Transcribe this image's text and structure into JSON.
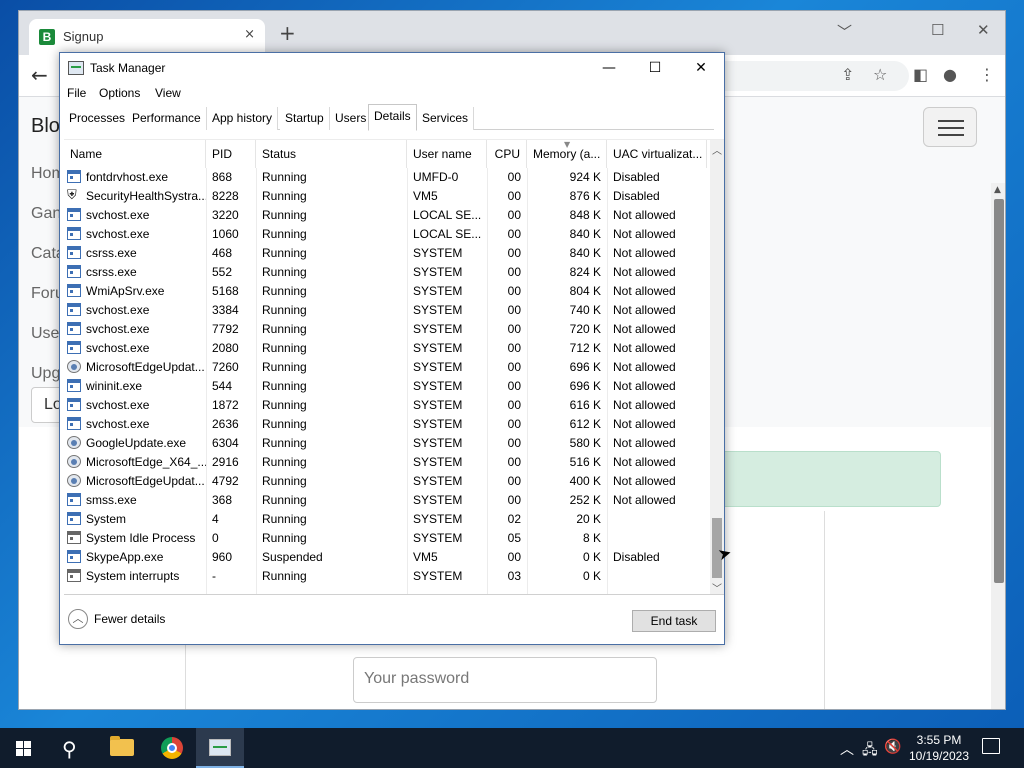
{
  "browser": {
    "tab_title": "Signup",
    "favicon_letter": "B",
    "tab_close": "×",
    "new_tab": "+",
    "back": "←",
    "win_min": "﹀",
    "win_max": "☐",
    "win_close": "✕",
    "page": {
      "brand": "Blo",
      "sidebar": [
        "Hom",
        "Gan",
        "Cata",
        "Foru",
        "Use",
        "Upg"
      ],
      "login_button": "Lo",
      "password_placeholder": "Your password"
    }
  },
  "task_manager": {
    "title": "Task Manager",
    "controls": {
      "minimize": "—",
      "maximize": "☐",
      "close": "✕"
    },
    "menu": [
      "File",
      "Options",
      "View"
    ],
    "tabs": [
      {
        "label": "Processes"
      },
      {
        "label": "Performance"
      },
      {
        "label": "App history"
      },
      {
        "label": "Startup"
      },
      {
        "label": "Users"
      },
      {
        "label": "Details",
        "active": true
      },
      {
        "label": "Services"
      }
    ],
    "columns": [
      "Name",
      "PID",
      "Status",
      "User name",
      "CPU",
      "Memory (a...",
      "UAC virtualizat..."
    ],
    "rows": [
      {
        "name": "fontdrvhost.exe",
        "pid": "868",
        "status": "Running",
        "user": "UMFD-0",
        "cpu": "00",
        "memory": "924 K",
        "uac": "Disabled",
        "icon": "app"
      },
      {
        "name": "SecurityHealthSystra...",
        "pid": "8228",
        "status": "Running",
        "user": "VM5",
        "cpu": "00",
        "memory": "876 K",
        "uac": "Disabled",
        "icon": "shield"
      },
      {
        "name": "svchost.exe",
        "pid": "3220",
        "status": "Running",
        "user": "LOCAL SE...",
        "cpu": "00",
        "memory": "848 K",
        "uac": "Not allowed",
        "icon": "app"
      },
      {
        "name": "svchost.exe",
        "pid": "1060",
        "status": "Running",
        "user": "LOCAL SE...",
        "cpu": "00",
        "memory": "840 K",
        "uac": "Not allowed",
        "icon": "app"
      },
      {
        "name": "csrss.exe",
        "pid": "468",
        "status": "Running",
        "user": "SYSTEM",
        "cpu": "00",
        "memory": "840 K",
        "uac": "Not allowed",
        "icon": "app"
      },
      {
        "name": "csrss.exe",
        "pid": "552",
        "status": "Running",
        "user": "SYSTEM",
        "cpu": "00",
        "memory": "824 K",
        "uac": "Not allowed",
        "icon": "app"
      },
      {
        "name": "WmiApSrv.exe",
        "pid": "5168",
        "status": "Running",
        "user": "SYSTEM",
        "cpu": "00",
        "memory": "804 K",
        "uac": "Not allowed",
        "icon": "app"
      },
      {
        "name": "svchost.exe",
        "pid": "3384",
        "status": "Running",
        "user": "SYSTEM",
        "cpu": "00",
        "memory": "740 K",
        "uac": "Not allowed",
        "icon": "app"
      },
      {
        "name": "svchost.exe",
        "pid": "7792",
        "status": "Running",
        "user": "SYSTEM",
        "cpu": "00",
        "memory": "720 K",
        "uac": "Not allowed",
        "icon": "app"
      },
      {
        "name": "svchost.exe",
        "pid": "2080",
        "status": "Running",
        "user": "SYSTEM",
        "cpu": "00",
        "memory": "712 K",
        "uac": "Not allowed",
        "icon": "app"
      },
      {
        "name": "MicrosoftEdgeUpdat...",
        "pid": "7260",
        "status": "Running",
        "user": "SYSTEM",
        "cpu": "00",
        "memory": "696 K",
        "uac": "Not allowed",
        "icon": "update"
      },
      {
        "name": "wininit.exe",
        "pid": "544",
        "status": "Running",
        "user": "SYSTEM",
        "cpu": "00",
        "memory": "696 K",
        "uac": "Not allowed",
        "icon": "app"
      },
      {
        "name": "svchost.exe",
        "pid": "1872",
        "status": "Running",
        "user": "SYSTEM",
        "cpu": "00",
        "memory": "616 K",
        "uac": "Not allowed",
        "icon": "app"
      },
      {
        "name": "svchost.exe",
        "pid": "2636",
        "status": "Running",
        "user": "SYSTEM",
        "cpu": "00",
        "memory": "612 K",
        "uac": "Not allowed",
        "icon": "app"
      },
      {
        "name": "GoogleUpdate.exe",
        "pid": "6304",
        "status": "Running",
        "user": "SYSTEM",
        "cpu": "00",
        "memory": "580 K",
        "uac": "Not allowed",
        "icon": "update"
      },
      {
        "name": "MicrosoftEdge_X64_...",
        "pid": "2916",
        "status": "Running",
        "user": "SYSTEM",
        "cpu": "00",
        "memory": "516 K",
        "uac": "Not allowed",
        "icon": "update"
      },
      {
        "name": "MicrosoftEdgeUpdat...",
        "pid": "4792",
        "status": "Running",
        "user": "SYSTEM",
        "cpu": "00",
        "memory": "400 K",
        "uac": "Not allowed",
        "icon": "update"
      },
      {
        "name": "smss.exe",
        "pid": "368",
        "status": "Running",
        "user": "SYSTEM",
        "cpu": "00",
        "memory": "252 K",
        "uac": "Not allowed",
        "icon": "app"
      },
      {
        "name": "System",
        "pid": "4",
        "status": "Running",
        "user": "SYSTEM",
        "cpu": "02",
        "memory": "20 K",
        "uac": "",
        "icon": "app"
      },
      {
        "name": "System Idle Process",
        "pid": "0",
        "status": "Running",
        "user": "SYSTEM",
        "cpu": "05",
        "memory": "8 K",
        "uac": "",
        "icon": "grey"
      },
      {
        "name": "SkypeApp.exe",
        "pid": "960",
        "status": "Suspended",
        "user": "VM5",
        "cpu": "00",
        "memory": "0 K",
        "uac": "Disabled",
        "icon": "app"
      },
      {
        "name": "System interrupts",
        "pid": "-",
        "status": "Running",
        "user": "SYSTEM",
        "cpu": "03",
        "memory": "0 K",
        "uac": "",
        "icon": "grey"
      }
    ],
    "fewer_details": "Fewer details",
    "end_task": "End task"
  },
  "taskbar": {
    "search_glyph": "⚲",
    "tray_chevron": "︿",
    "tray_network": "🖧",
    "tray_volume": "🔇",
    "time": "3:55 PM",
    "date": "10/19/2023"
  }
}
